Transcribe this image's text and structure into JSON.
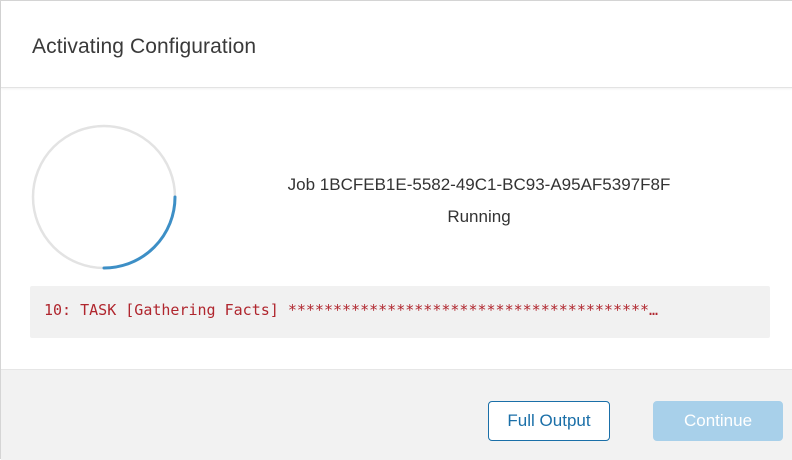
{
  "dialog": {
    "title": "Activating Configuration"
  },
  "job": {
    "label": "Job 1BCFEB1E-5582-49C1-BC93-A95AF5397F8F",
    "status": "Running",
    "progress_icon": "spinner-icon"
  },
  "log": {
    "line": "10: TASK [Gathering Facts] ****************************************…"
  },
  "footer": {
    "full_output_label": "Full Output",
    "continue_label": "Continue"
  },
  "colors": {
    "spinner_track": "#e3e3e3",
    "spinner_arc": "#3d8fc6",
    "log_text": "#b0262e",
    "primary_disabled": "#a8d0ea",
    "secondary_border": "#1a6fa8"
  }
}
